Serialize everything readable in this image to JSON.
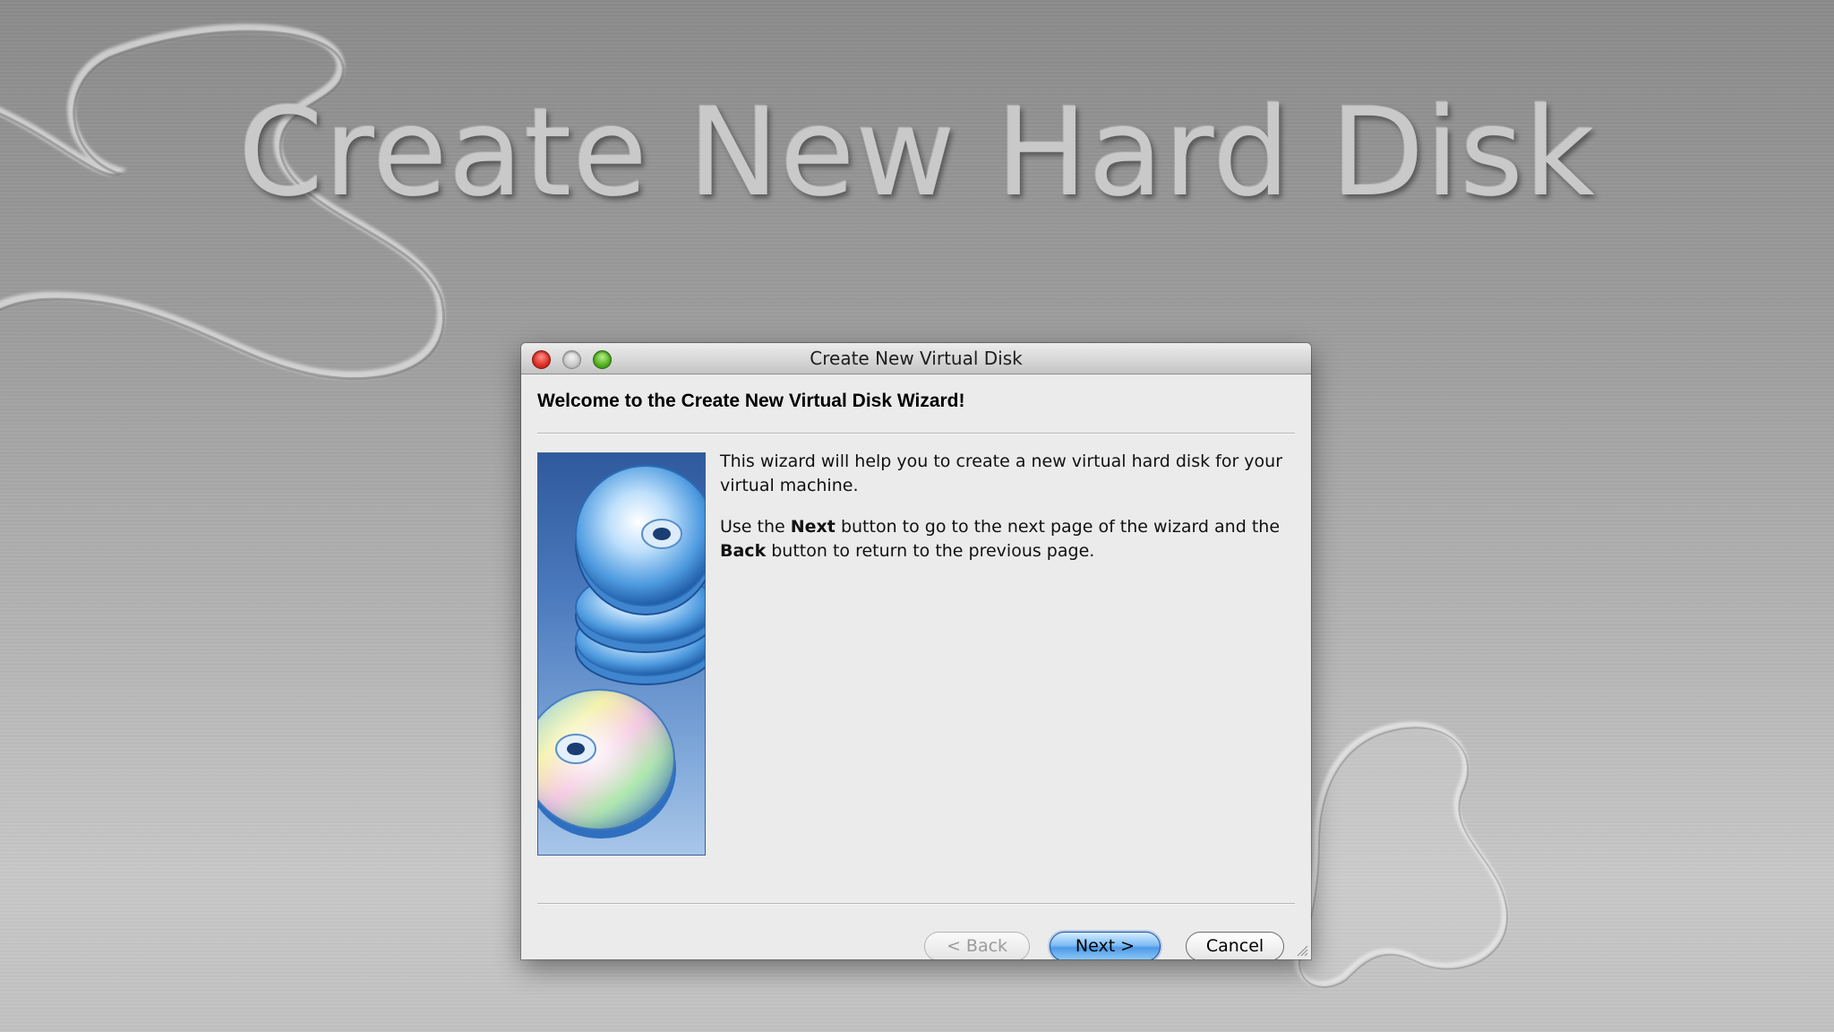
{
  "slide": {
    "title": "Create New Hard Disk"
  },
  "window": {
    "title": "Create New Virtual Disk"
  },
  "wizard": {
    "heading": "Welcome to the Create New Virtual Disk Wizard!",
    "paragraph1": "This wizard will help you to create a new virtual hard disk for your virtual machine.",
    "paragraph2_part1": "Use the ",
    "paragraph2_bold1": "Next",
    "paragraph2_part2": " button to go to the next page of the wizard and the ",
    "paragraph2_bold2": "Back",
    "paragraph2_part3": " button to return to the previous page."
  },
  "buttons": {
    "back_label": "< Back",
    "next_label": "Next >",
    "cancel_label": "Cancel"
  },
  "icons": {
    "close": "close-button-icon",
    "minimize": "minimize-button-icon",
    "zoom": "zoom-button-icon",
    "wizard_art": "disk-stack-icon",
    "resize": "resize-grip-icon"
  },
  "colors": {
    "accent_default_button": "#4d9ae8",
    "close_red": "#e0352b",
    "zoom_green": "#58b524"
  }
}
